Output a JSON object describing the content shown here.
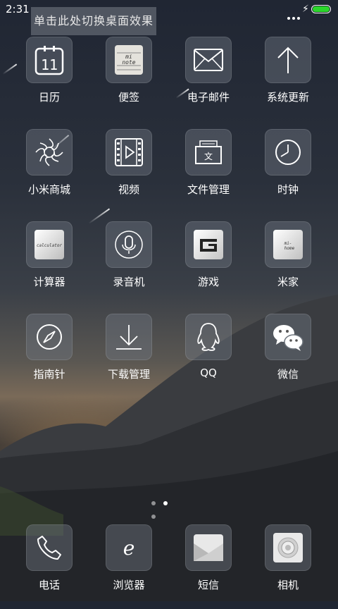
{
  "status": {
    "time": "2:31",
    "battery_color": "#2bd62b",
    "icons": [
      "more-dots-icon",
      "charging-bolt-icon",
      "battery-icon"
    ]
  },
  "toast": {
    "text": "单击此处切换桌面效果"
  },
  "apps": [
    {
      "label": "日历",
      "icon": "calendar-icon",
      "icon_text": "11"
    },
    {
      "label": "便签",
      "icon": "notes-icon",
      "icon_text": "mi\nnote"
    },
    {
      "label": "电子邮件",
      "icon": "mail-icon"
    },
    {
      "label": "系统更新",
      "icon": "update-arrow-icon"
    },
    {
      "label": "小米商城",
      "icon": "store-icon"
    },
    {
      "label": "视频",
      "icon": "video-icon"
    },
    {
      "label": "文件管理",
      "icon": "file-manager-icon",
      "icon_text": "文"
    },
    {
      "label": "时钟",
      "icon": "clock-icon"
    },
    {
      "label": "计算器",
      "icon": "calculator-icon",
      "icon_text": "calculator"
    },
    {
      "label": "录音机",
      "icon": "microphone-icon"
    },
    {
      "label": "游戏",
      "icon": "game-icon"
    },
    {
      "label": "米家",
      "icon": "mihome-icon",
      "icon_text": "mi-home"
    },
    {
      "label": "指南针",
      "icon": "compass-icon"
    },
    {
      "label": "下载管理",
      "icon": "download-icon"
    },
    {
      "label": "QQ",
      "icon": "qq-penguin-icon"
    },
    {
      "label": "微信",
      "icon": "wechat-icon"
    }
  ],
  "pager": {
    "pages": 3,
    "current": 2
  },
  "dock": [
    {
      "label": "电话",
      "icon": "phone-icon"
    },
    {
      "label": "浏览器",
      "icon": "browser-icon",
      "icon_text": "e"
    },
    {
      "label": "短信",
      "icon": "messages-icon"
    },
    {
      "label": "相机",
      "icon": "camera-icon"
    }
  ]
}
